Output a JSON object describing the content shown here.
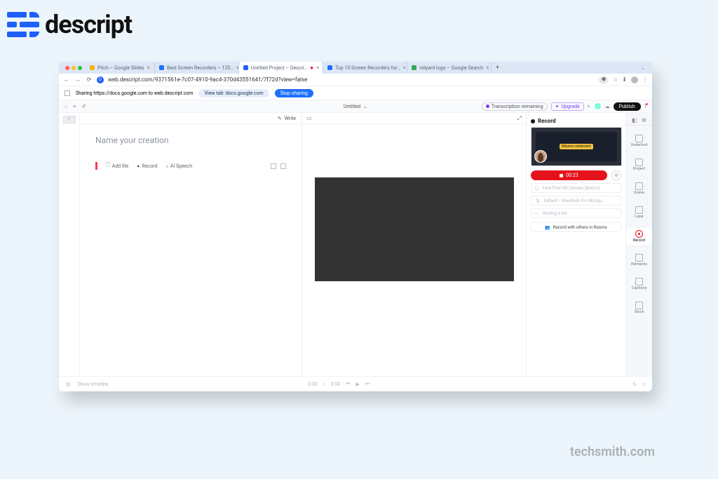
{
  "brand": {
    "name": "descript"
  },
  "watermark": "techsmith.com",
  "tabs": [
    {
      "label": "Pitch – Google Slides",
      "favcolor": "#f4b400"
    },
    {
      "label": "Best Screen Recorders – 120…",
      "favcolor": "#1e70ff"
    },
    {
      "label": "Untitled Project – Descri…",
      "favcolor": "#1e60fa",
      "active": true,
      "recording": true
    },
    {
      "label": "Top 10 Screen Recorders for…",
      "favcolor": "#1e70ff"
    },
    {
      "label": "vidyard logo – Google Search",
      "favcolor": "#34a853"
    }
  ],
  "address": {
    "url": "web.descript.com/9371561e-7c07-4910-9ac4-370d43551641/7f72d?view=false",
    "gem": "⬢"
  },
  "sharebar": {
    "text": "Sharing https://docs.google.com to web.descript.com",
    "view_tab": "View tab: docs.google.com",
    "stop": "Stop sharing"
  },
  "appbar": {
    "title": "Untitled",
    "transcription": "Transcription remaining",
    "upgrade": "Upgrade",
    "publish": "Publish"
  },
  "editor": {
    "write": "Write",
    "placeholder": "Name your creation",
    "addfile": "Add file",
    "record": "Record",
    "aispeech": "AI Speech"
  },
  "record": {
    "title": "Record",
    "slide_label": "Mission statement",
    "time": "00:23",
    "camera": "FaceTime HD Camera (Built-in)",
    "mic": "Default – MacBook Pro Microp…",
    "screen": "Sharing a tab",
    "rooms": "Record with others in Rooms"
  },
  "rail": {
    "items": [
      "Underlord",
      "Project",
      "Scene",
      "Layer",
      "Record",
      "Elements",
      "Captions",
      "Stock"
    ]
  },
  "transport": {
    "show_timeline": "Show timeline",
    "time": "0:00",
    "dur": "0:04"
  }
}
